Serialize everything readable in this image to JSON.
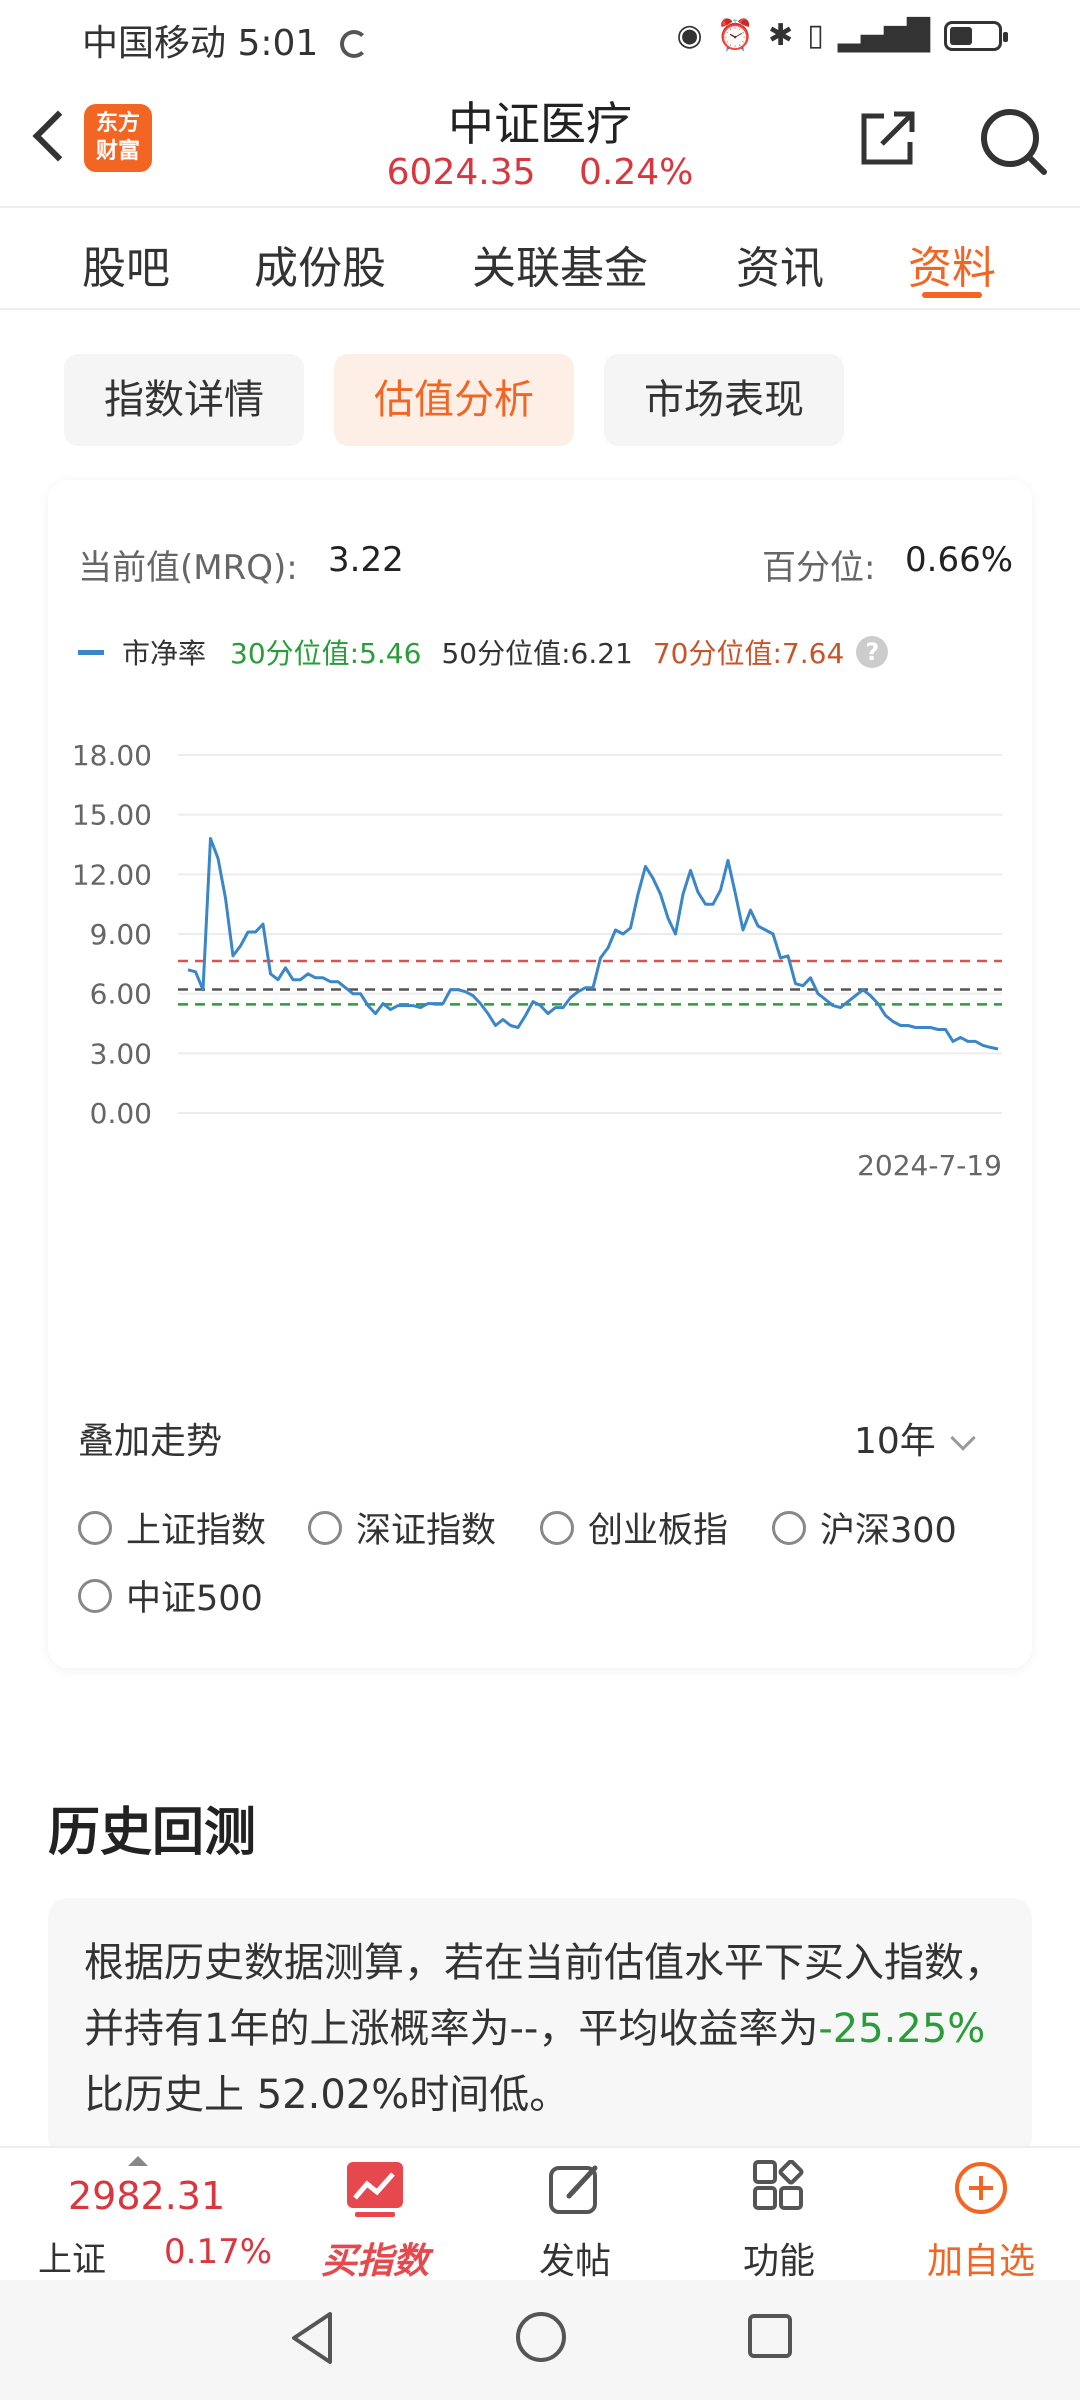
{
  "status_bar": {
    "carrier": "中国移动",
    "time": "5:01"
  },
  "header": {
    "logo_text_1": "东方",
    "logo_text_2": "财富",
    "title": "中证医疗",
    "price": "6024.35",
    "change": "0.24%"
  },
  "tabs": [
    {
      "label": "股吧"
    },
    {
      "label": "成份股"
    },
    {
      "label": "关联基金"
    },
    {
      "label": "资讯"
    },
    {
      "label": "资料",
      "active": true
    }
  ],
  "sub_tabs": [
    {
      "label": "指数详情"
    },
    {
      "label": "估值分析",
      "active": true
    },
    {
      "label": "市场表现"
    }
  ],
  "valuation": {
    "current_label": "当前值(MRQ):",
    "current_value": "3.22",
    "percentile_label": "百分位:",
    "percentile_value": "0.66%"
  },
  "legend": {
    "series": "市净率",
    "p30": "30分位值:5.46",
    "p50": "50分位值:6.21",
    "p70": "70分位值:7.64",
    "help": "?"
  },
  "colors": {
    "series": "#3a86c8",
    "p30": "#2a9d3a",
    "p50": "#555555",
    "p70": "#d9534f",
    "accent": "#f26522",
    "rise": "#d9363e"
  },
  "chart_data": {
    "type": "line",
    "ylim": [
      0,
      18
    ],
    "y_ticks": [
      "18.00",
      "15.00",
      "12.00",
      "9.00",
      "6.00",
      "3.00",
      "0.00"
    ],
    "x_end_label": "2024-7-19",
    "series": [
      {
        "name": "市净率",
        "values": [
          7.2,
          7.1,
          6.2,
          13.8,
          12.8,
          10.8,
          7.9,
          8.4,
          9.1,
          9.1,
          9.5,
          7.0,
          6.7,
          7.3,
          6.7,
          6.7,
          7.0,
          6.8,
          6.8,
          6.6,
          6.6,
          6.3,
          6.0,
          6.0,
          5.4,
          5.0,
          5.5,
          5.2,
          5.4,
          5.4,
          5.4,
          5.3,
          5.5,
          5.5,
          5.5,
          6.2,
          6.2,
          6.1,
          5.9,
          5.5,
          5.0,
          4.4,
          4.7,
          4.4,
          4.3,
          4.9,
          5.6,
          5.4,
          5.0,
          5.3,
          5.3,
          5.8,
          6.1,
          6.3,
          6.3,
          7.8,
          8.3,
          9.2,
          9.0,
          9.3,
          11.0,
          12.4,
          11.8,
          11.0,
          9.8,
          9.0,
          11.0,
          12.2,
          11.1,
          10.5,
          10.5,
          11.2,
          12.7,
          11.0,
          9.2,
          10.2,
          9.4,
          9.2,
          9.0,
          7.8,
          7.9,
          6.5,
          6.4,
          6.8,
          6.0,
          5.7,
          5.4,
          5.3,
          5.6,
          5.9,
          6.2,
          5.9,
          5.5,
          4.9,
          4.6,
          4.4,
          4.4,
          4.3,
          4.3,
          4.3,
          4.2,
          4.2,
          3.6,
          3.8,
          3.6,
          3.6,
          3.4,
          3.3,
          3.22
        ]
      }
    ],
    "reference_lines": [
      {
        "label": "70分位值",
        "value": 7.64
      },
      {
        "label": "50分位值",
        "value": 6.21
      },
      {
        "label": "30分位值",
        "value": 5.46
      }
    ],
    "grid": true
  },
  "overlay": {
    "label": "叠加走势",
    "period": "10年",
    "options": [
      "上证指数",
      "深证指数",
      "创业板指",
      "沪深300",
      "中证500"
    ]
  },
  "history": {
    "title": "历史回测",
    "text_part1": "根据历史数据测算，若在当前估值水平下买入指数，并持有1年的上涨概率为--，平均收益率为",
    "text_green": "-25.25%",
    "text_part2": "比历史上 52.02%时间低。"
  },
  "bottom_bar": {
    "index_value": "2982.31",
    "index_name": "上证",
    "index_change": "0.17%",
    "buy_label": "买指数",
    "post_label": "发帖",
    "func_label": "功能",
    "fav_label": "加自选"
  }
}
